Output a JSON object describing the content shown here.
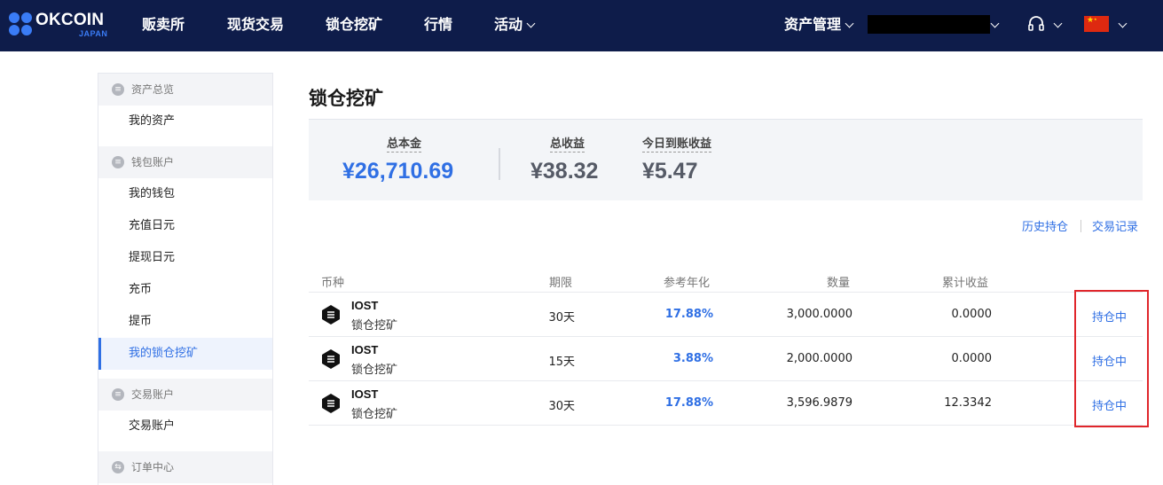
{
  "header": {
    "logo_text": "OKCOIN",
    "logo_sub": "JAPAN",
    "nav": [
      "贩卖所",
      "现货交易",
      "锁仓挖矿",
      "行情",
      "活动"
    ],
    "asset_mgmt": "资产管理"
  },
  "sidebar": {
    "groups": [
      {
        "title": "资产总览",
        "items": [
          "我的资产"
        ]
      },
      {
        "title": "钱包账户",
        "items": [
          "我的钱包",
          "充值日元",
          "提现日元",
          "充币",
          "提币",
          "我的锁仓挖矿"
        ]
      },
      {
        "title": "交易账户",
        "items": [
          "交易账户"
        ]
      },
      {
        "title": "订单中心",
        "items": []
      }
    ],
    "active_item": "我的锁仓挖矿"
  },
  "main": {
    "title": "锁仓挖矿",
    "summary": {
      "principal_label": "总本金",
      "principal_value": "¥26,710.69",
      "earnings_label": "总收益",
      "earnings_value": "¥38.32",
      "today_label": "今日到账收益",
      "today_value": "¥5.47"
    },
    "links": {
      "history": "历史持仓",
      "records": "交易记录"
    },
    "table": {
      "columns": [
        "币种",
        "期限",
        "参考年化",
        "数量",
        "累计收益"
      ],
      "rows": [
        {
          "coin": "IOST",
          "product": "锁仓挖矿",
          "term": "30天",
          "rate": "17.88%",
          "amount": "3,000.0000",
          "earnings": "0.0000",
          "status": "持仓中"
        },
        {
          "coin": "IOST",
          "product": "锁仓挖矿",
          "term": "15天",
          "rate": "3.88%",
          "amount": "2,000.0000",
          "earnings": "0.0000",
          "status": "持仓中"
        },
        {
          "coin": "IOST",
          "product": "锁仓挖矿",
          "term": "30天",
          "rate": "17.88%",
          "amount": "3,596.9879",
          "earnings": "12.3342",
          "status": "持仓中"
        }
      ]
    }
  },
  "colors": {
    "nav_bg": "#0e1c4a",
    "accent": "#2f6fe4",
    "highlight_box": "#e0262b"
  }
}
